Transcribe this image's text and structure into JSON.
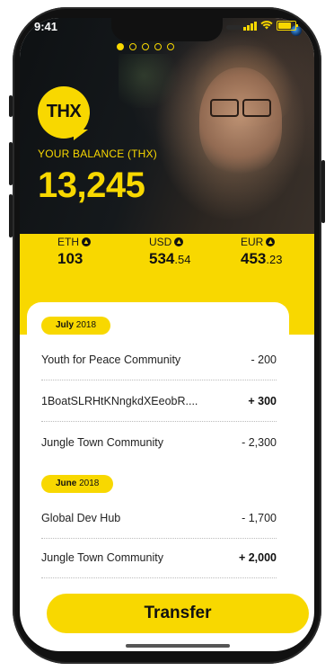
{
  "status": {
    "time": "9:41"
  },
  "onboarding": {
    "pages": 5,
    "active_index": 0
  },
  "brand": {
    "logo_text": "THX"
  },
  "balance": {
    "label": "YOUR BALANCE (THX)",
    "value": "13,245"
  },
  "currencies": [
    {
      "code": "ETH",
      "whole": "103",
      "fraction": ""
    },
    {
      "code": "USD",
      "whole": "534",
      "fraction": ".54"
    },
    {
      "code": "EUR",
      "whole": "453",
      "fraction": ".23"
    }
  ],
  "history": [
    {
      "month": "July",
      "year": "2018",
      "transactions": [
        {
          "name": "Youth for Peace Community",
          "amount": "- 200",
          "positive": false
        },
        {
          "name": "1BoatSLRHtKNngkdXEeobR....",
          "amount": "+ 300",
          "positive": true
        },
        {
          "name": "Jungle Town Community",
          "amount": "- 2,300",
          "positive": false
        }
      ]
    },
    {
      "month": "June",
      "year": "2018",
      "transactions": [
        {
          "name": "Global Dev Hub",
          "amount": "- 1,700",
          "positive": false
        },
        {
          "name": "Jungle Town Community",
          "amount": "+ 2,000",
          "positive": true
        }
      ]
    }
  ],
  "actions": {
    "transfer_label": "Transfer"
  },
  "colors": {
    "accent": "#f8d800",
    "dark": "#111111"
  }
}
